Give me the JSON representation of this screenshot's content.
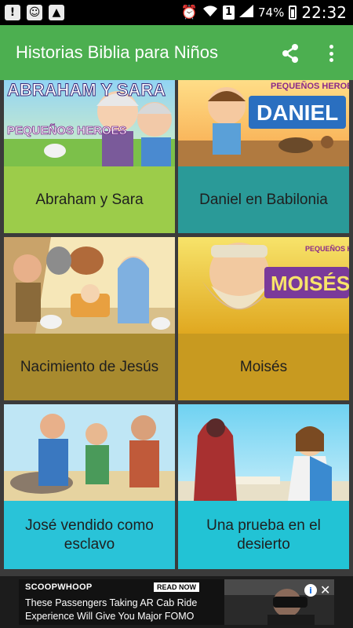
{
  "status_bar": {
    "battery": "74%",
    "time": "22:32",
    "sim_slot": "1",
    "left_icons": [
      "notification-alert-icon",
      "messenger-icon",
      "gallery-icon"
    ],
    "right_icons": [
      "alarm-icon",
      "wifi-icon",
      "signal-icon",
      "battery-icon"
    ]
  },
  "app_bar": {
    "title": "Historias Biblia para Niños",
    "color": "#4caf50",
    "actions": [
      "share-icon",
      "overflow-menu-icon"
    ]
  },
  "grid": {
    "items": [
      {
        "label": "Abraham y Sara",
        "thumb_title": "ABRAHAM Y SARA",
        "thumb_badge": "PEQUEÑOS HEROES",
        "color": "#9ccc4a"
      },
      {
        "label": "Daniel en Babilonia",
        "thumb_title": "DANIEL",
        "thumb_badge": "PEQUEÑOS HEROES",
        "color": "#2a9a98"
      },
      {
        "label": "Nacimiento de Jesús",
        "thumb_title": "",
        "thumb_badge": "",
        "color": "#a88a2e"
      },
      {
        "label": "Moisés",
        "thumb_title": "MOISÉS",
        "thumb_badge": "PEQUEÑOS HEROES",
        "color": "#c89a20"
      },
      {
        "label": "José vendido como esclavo",
        "thumb_title": "",
        "thumb_badge": "",
        "color": "#29c3d8"
      },
      {
        "label": "Una prueba en el desierto",
        "thumb_title": "",
        "thumb_badge": "",
        "color": "#22c3d5"
      }
    ]
  },
  "ad": {
    "brand": "SCOOPWHOOP",
    "cta": "READ NOW",
    "headline": "These Passengers Taking AR Cab Ride Experience Will Give You Major FOMO",
    "info": "i",
    "close": "✕"
  }
}
